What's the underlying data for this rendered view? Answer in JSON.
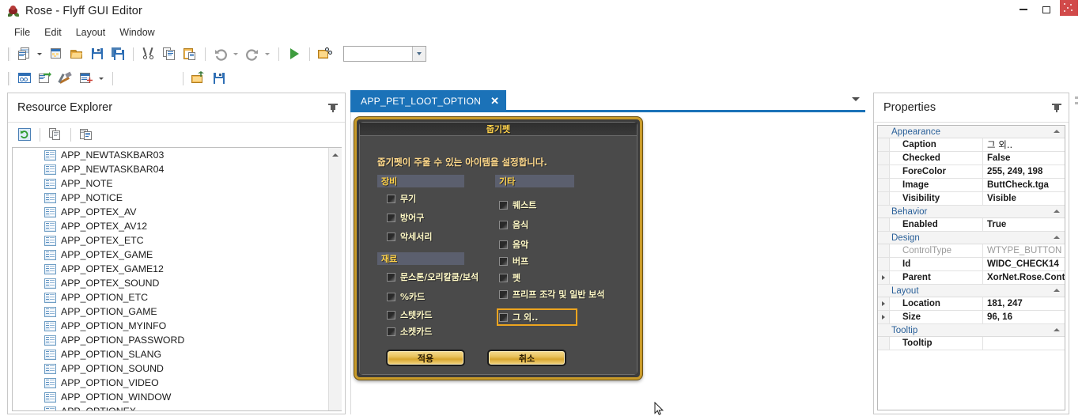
{
  "window": {
    "title": "Rose - Flyff GUI Editor",
    "app_icon": "rose-icon",
    "minimize_label": "Minimize",
    "maximize_label": "Maximize",
    "close_label": "Close"
  },
  "menubar": {
    "items": [
      {
        "label": "File",
        "name": "menu-file"
      },
      {
        "label": "Edit",
        "name": "menu-edit"
      },
      {
        "label": "Layout",
        "name": "menu-layout"
      },
      {
        "label": "Window",
        "name": "menu-window"
      }
    ]
  },
  "toolbar1": {
    "buttons": [
      {
        "name": "new-project-icon",
        "title": "New"
      },
      {
        "name": "new-item-icon",
        "title": "New Item"
      },
      {
        "name": "open-folder-icon",
        "title": "Open"
      },
      {
        "name": "save-icon",
        "title": "Save"
      },
      {
        "name": "save-all-icon",
        "title": "Save All"
      },
      {
        "name": "cut-icon",
        "title": "Cut"
      },
      {
        "name": "copy-icon",
        "title": "Copy"
      },
      {
        "name": "paste-icon",
        "title": "Paste"
      },
      {
        "name": "undo-icon",
        "title": "Undo"
      },
      {
        "name": "redo-icon",
        "title": "Redo"
      },
      {
        "name": "run-icon",
        "title": "Run"
      },
      {
        "name": "find-in-files-icon",
        "title": "Find"
      }
    ],
    "combo": {
      "value": "",
      "placeholder": ""
    }
  },
  "toolbar2": {
    "buttons": [
      {
        "name": "properties-window-icon",
        "title": "Properties Window"
      },
      {
        "name": "resource-editor-icon",
        "title": "Resource Editor"
      },
      {
        "name": "tools-icon",
        "title": "Tools"
      },
      {
        "name": "add-control-icon",
        "title": "Add Control"
      },
      {
        "name": "export-icon",
        "title": "Export"
      },
      {
        "name": "save-resource-icon",
        "title": "Save Resource"
      }
    ]
  },
  "resource_explorer": {
    "title": "Resource Explorer",
    "pin_label": "Auto Hide",
    "toolbar": [
      {
        "name": "refresh-icon",
        "title": "Refresh"
      },
      {
        "name": "copy-resource-icon",
        "title": "Copy"
      },
      {
        "name": "paste-resource-icon",
        "title": "Paste"
      }
    ],
    "items": [
      "APP_NEWTASKBAR03",
      "APP_NEWTASKBAR04",
      "APP_NOTE",
      "APP_NOTICE",
      "APP_OPTEX_AV",
      "APP_OPTEX_AV12",
      "APP_OPTEX_ETC",
      "APP_OPTEX_GAME",
      "APP_OPTEX_GAME12",
      "APP_OPTEX_SOUND",
      "APP_OPTION_ETC",
      "APP_OPTION_GAME",
      "APP_OPTION_MYINFO",
      "APP_OPTION_PASSWORD",
      "APP_OPTION_SLANG",
      "APP_OPTION_SOUND",
      "APP_OPTION_VIDEO",
      "APP_OPTION_WINDOW",
      "APP_OPTIONEX"
    ]
  },
  "document": {
    "tab": {
      "label": "APP_PET_LOOT_OPTION",
      "close_label": "✕"
    },
    "tab_menu_label": "Tab list"
  },
  "game_dialog": {
    "title": "줍기펫",
    "description": "줍기펫이 주울 수 있는 아이템을 설정합니다.",
    "groups": [
      {
        "header": "장비",
        "name": "group-equipment",
        "items": [
          {
            "label": "무기",
            "checked": false
          },
          {
            "label": "방어구",
            "checked": false
          },
          {
            "label": "악세서리",
            "checked": false
          }
        ]
      },
      {
        "header": "재료",
        "name": "group-materials",
        "items": [
          {
            "label": "문스톤/오리칼쿰/보석",
            "checked": false
          },
          {
            "label": "%카드",
            "checked": false
          },
          {
            "label": "스텟카드",
            "checked": false
          },
          {
            "label": "소켓카드",
            "checked": false
          }
        ]
      },
      {
        "header": "기타",
        "name": "group-etc",
        "items": [
          {
            "label": "퀘스트",
            "checked": false
          },
          {
            "label": "음식",
            "checked": false
          },
          {
            "label": "음악",
            "checked": false
          },
          {
            "label": "버프",
            "checked": false
          },
          {
            "label": "펫",
            "checked": false
          },
          {
            "label": "프리프 조각 및 일반 보석",
            "checked": false
          },
          {
            "label": "그 외..",
            "checked": false,
            "selected": true
          }
        ]
      }
    ],
    "buttons": [
      {
        "label": "적용",
        "name": "apply-button"
      },
      {
        "label": "취소",
        "name": "cancel-button"
      }
    ],
    "colors": {
      "border": "#c99b2a",
      "background": "#4a4a4a",
      "title_text": "#ffd24b",
      "label_text": "#fff9c6",
      "selection_outline": "#eda51f"
    }
  },
  "properties": {
    "title": "Properties",
    "pin_label": "Auto Hide",
    "categories": [
      {
        "name": "Appearance",
        "rows": [
          {
            "name": "Caption",
            "value": "그 외..",
            "readonly": false,
            "expandable": false,
            "korean": true
          },
          {
            "name": "Checked",
            "value": "False",
            "readonly": false,
            "expandable": false
          },
          {
            "name": "ForeColor",
            "value": "255, 249, 198",
            "readonly": false,
            "expandable": false
          },
          {
            "name": "Image",
            "value": "ButtCheck.tga",
            "readonly": false,
            "expandable": false
          },
          {
            "name": "Visibility",
            "value": "Visible",
            "readonly": false,
            "expandable": false
          }
        ]
      },
      {
        "name": "Behavior",
        "rows": [
          {
            "name": "Enabled",
            "value": "True",
            "readonly": false,
            "expandable": false
          }
        ]
      },
      {
        "name": "Design",
        "rows": [
          {
            "name": "ControlType",
            "value": "WTYPE_BUTTON",
            "readonly": true,
            "expandable": false
          },
          {
            "name": "Id",
            "value": "WIDC_CHECK14",
            "readonly": false,
            "expandable": false
          },
          {
            "name": "Parent",
            "value": "XorNet.Rose.Contr...",
            "readonly": false,
            "expandable": true
          }
        ]
      },
      {
        "name": "Layout",
        "rows": [
          {
            "name": "Location",
            "value": "181, 247",
            "readonly": false,
            "expandable": true
          },
          {
            "name": "Size",
            "value": "96, 16",
            "readonly": false,
            "expandable": true
          }
        ]
      },
      {
        "name": "Tooltip",
        "rows": [
          {
            "name": "Tooltip",
            "value": "",
            "readonly": false,
            "expandable": false
          }
        ]
      }
    ]
  }
}
